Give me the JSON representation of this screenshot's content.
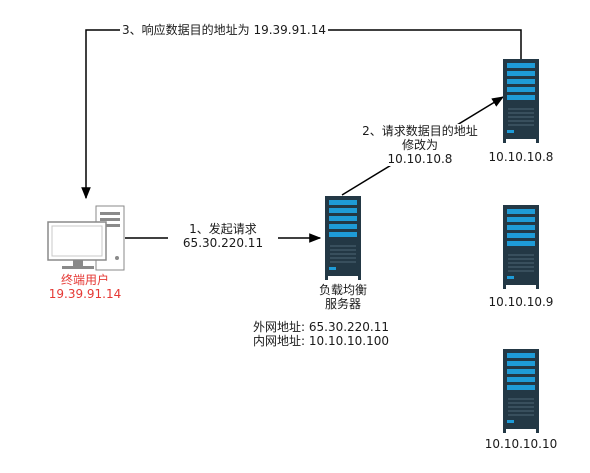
{
  "client": {
    "name": "终端用户",
    "ip": "19.39.91.14"
  },
  "load_balancer": {
    "name_line1": "负载均衡",
    "name_line2": "服务器",
    "external": "外网地址: 65.30.220.11",
    "internal": "内网地址: 10.10.10.100"
  },
  "servers": [
    {
      "ip": "10.10.10.8"
    },
    {
      "ip": "10.10.10.9"
    },
    {
      "ip": "10.10.10.10"
    }
  ],
  "arrows": {
    "step1_line1": "1、发起请求",
    "step1_line2": "65.30.220.11",
    "step2_line1": "2、请求数据目的地址",
    "step2_line2": "修改为",
    "step2_line3": "10.10.10.8",
    "step3": "3、响应数据目的地址为 19.39.91.14"
  },
  "colors": {
    "server_body": "#233845",
    "server_accent": "#1e9bd7",
    "client_label": "#e53935"
  }
}
